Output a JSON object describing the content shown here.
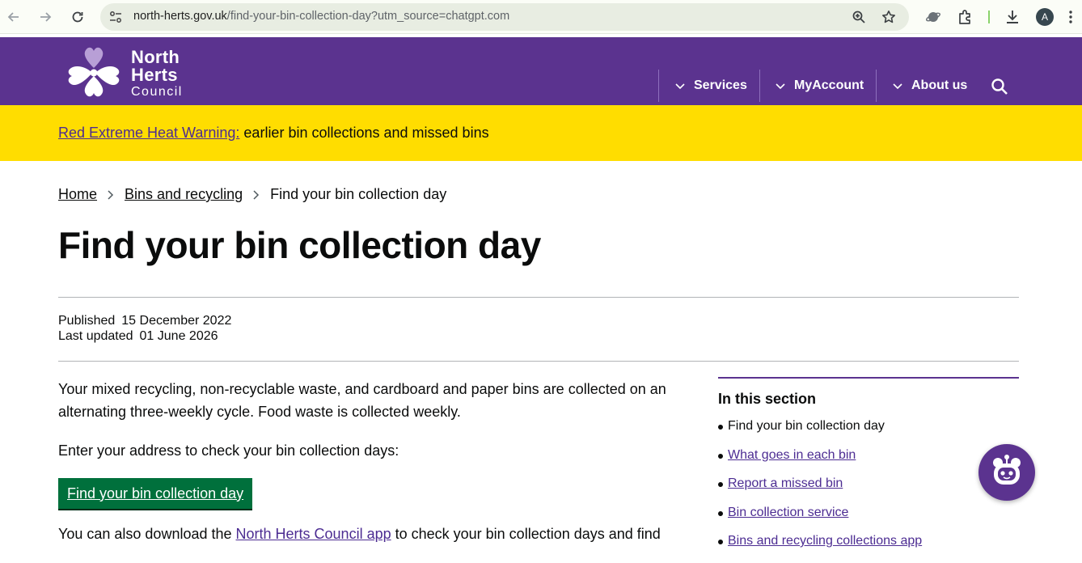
{
  "browser": {
    "url_host": "north-herts.gov.uk",
    "url_rest": "/find-your-bin-collection-day?utm_source=chatgpt.com",
    "avatar_letter": "A"
  },
  "header": {
    "logo_line1": "North",
    "logo_line2": "Herts",
    "logo_line3": "Council",
    "nav": [
      {
        "label": "Services"
      },
      {
        "label": "MyAccount"
      },
      {
        "label": "About us"
      }
    ]
  },
  "alert": {
    "link_text": "Red Extreme Heat Warning:",
    "text": " earlier bin collections and missed bins"
  },
  "breadcrumb": {
    "home": "Home",
    "section": "Bins and recycling",
    "current": "Find your bin collection day"
  },
  "page": {
    "title": "Find your bin collection day",
    "published_label": "Published",
    "published_date": "15 December 2022",
    "updated_label": "Last updated",
    "updated_date": "01 June 2026",
    "intro": "Your mixed recycling, non-recyclable waste, and cardboard and paper bins are collected on an alternating three-weekly cycle. Food waste is collected weekly.",
    "prompt": "Enter your address to check your bin collection days:",
    "cta_label": "Find your bin collection day",
    "app_text_before": "You can also download the ",
    "app_link": "North Herts Council app",
    "app_text_after": " to check your bin collection days and find"
  },
  "side": {
    "title": "In this section",
    "current": "Find your bin collection day",
    "links": [
      "What goes in each bin",
      "Report a missed bin",
      "Bin collection service",
      "Bins and recycling collections app"
    ]
  },
  "colors": {
    "brand_purple": "#5b338f",
    "alert_yellow": "#ffdd00",
    "cta_green": "#00703c",
    "link_purple": "#4c2c92"
  }
}
